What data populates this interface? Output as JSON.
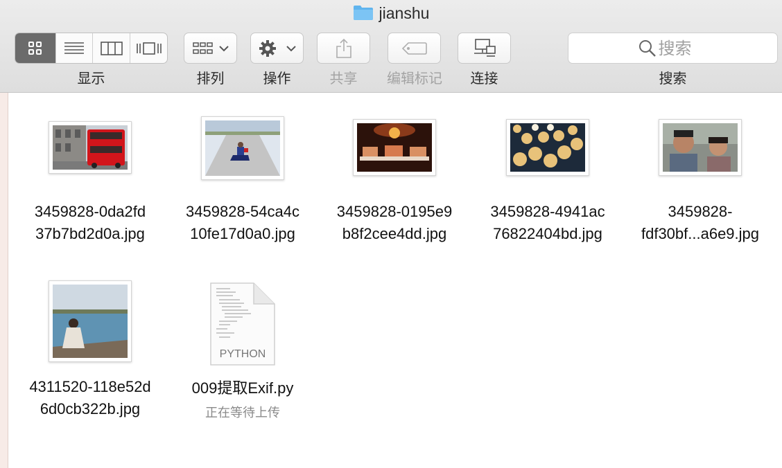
{
  "window": {
    "title": "jianshu",
    "title_icon": "folder-icon"
  },
  "toolbar": {
    "view_label": "显示",
    "view_modes": [
      "icon-view",
      "list-view",
      "column-view",
      "cover-flow-view"
    ],
    "arrange_label": "排列",
    "action_label": "操作",
    "share_label": "共享",
    "tags_label": "编辑标记",
    "connect_label": "连接",
    "search_label": "搜索",
    "search_placeholder": "搜索"
  },
  "files": [
    {
      "name": "3459828-0da2fd\n37b7bd2d0a.jpg",
      "thumb": "red-double-decker-bus"
    },
    {
      "name": "3459828-54ca4c\n10fe17d0a0.jpg",
      "thumb": "person-sitting-on-road"
    },
    {
      "name": "3459828-0195e9\nb8f2cee4dd.jpg",
      "thumb": "food-on-dark-table"
    },
    {
      "name": "3459828-4941ac\n76822404bd.jpg",
      "thumb": "grilled-dumplings"
    },
    {
      "name": "3459828-\nfdf30bf...a6e9.jpg",
      "thumb": "two-children"
    },
    {
      "name": "4311520-118e52d\n6d0cb322b.jpg",
      "thumb": "woman-by-sea"
    },
    {
      "name": "009提取Exif.py",
      "thumb": "python-document",
      "file_type": "PYTHON",
      "status": "正在等待上传"
    }
  ],
  "colors": {
    "accent": "#3f9de4",
    "selected_segment": "#6b6b6b"
  }
}
